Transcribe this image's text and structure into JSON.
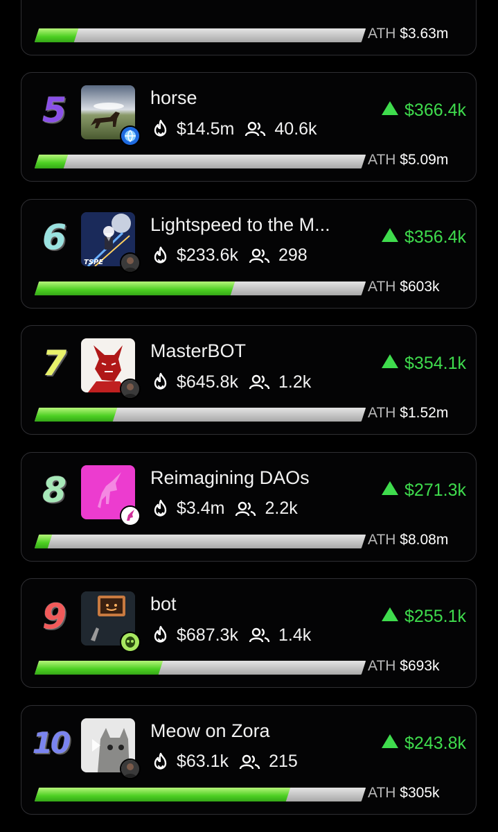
{
  "partial_card": {
    "ath_value": "$3.63m",
    "progress": 0.12
  },
  "cards": [
    {
      "rank": "5",
      "rank_color": "#8a50e8",
      "name": "horse",
      "market_cap": "$14.5m",
      "holders": "40.6k",
      "change": "$366.4k",
      "ath_label": "ATH",
      "ath_value": "$5.09m",
      "progress": 0.09,
      "thumb_icon": "horse-photo",
      "badge_icon": "globe-badge-icon"
    },
    {
      "rank": "6",
      "rank_color": "#9ae2e0",
      "name": "Lightspeed to the M...",
      "market_cap": "$233.6k",
      "holders": "298",
      "change": "$356.4k",
      "ath_label": "ATH",
      "ath_value": "$603k",
      "progress": 0.6,
      "thumb_icon": "lightspeed-video-thumb",
      "badge_icon": "avatar-badge-icon"
    },
    {
      "rank": "7",
      "rank_color": "#e8f26a",
      "name": "MasterBOT",
      "market_cap": "$645.8k",
      "holders": "1.2k",
      "change": "$354.1k",
      "ath_label": "ATH",
      "ath_value": "$1.52m",
      "progress": 0.24,
      "thumb_icon": "red-dog-robot-thumb",
      "badge_icon": "avatar-badge-icon"
    },
    {
      "rank": "8",
      "rank_color": "#a6e8b8",
      "name": "Reimagining DAOs",
      "market_cap": "$3.4m",
      "holders": "2.2k",
      "change": "$271.3k",
      "ath_label": "ATH",
      "ath_value": "$8.08m",
      "progress": 0.04,
      "thumb_icon": "pink-unicorn-thumb",
      "badge_icon": "unicorn-badge-icon"
    },
    {
      "rank": "9",
      "rank_color": "#f15a5a",
      "name": "bot",
      "market_cap": "$687.3k",
      "holders": "1.4k",
      "change": "$255.1k",
      "ath_label": "ATH",
      "ath_value": "$693k",
      "progress": 0.38,
      "thumb_icon": "robot-tv-thumb",
      "badge_icon": "alien-badge-icon"
    },
    {
      "rank": "10",
      "rank_color": "#7a84f0",
      "name": "Meow on Zora",
      "market_cap": "$63.1k",
      "holders": "215",
      "change": "$243.8k",
      "ath_label": "ATH",
      "ath_value": "$305k",
      "progress": 0.77,
      "thumb_icon": "cat-video-thumb",
      "badge_icon": "avatar-badge-icon"
    }
  ],
  "colors": {
    "accent_green": "#3fdc4d",
    "bar_fill": "#4ccf22",
    "bar_track": "#c0c0c0"
  }
}
